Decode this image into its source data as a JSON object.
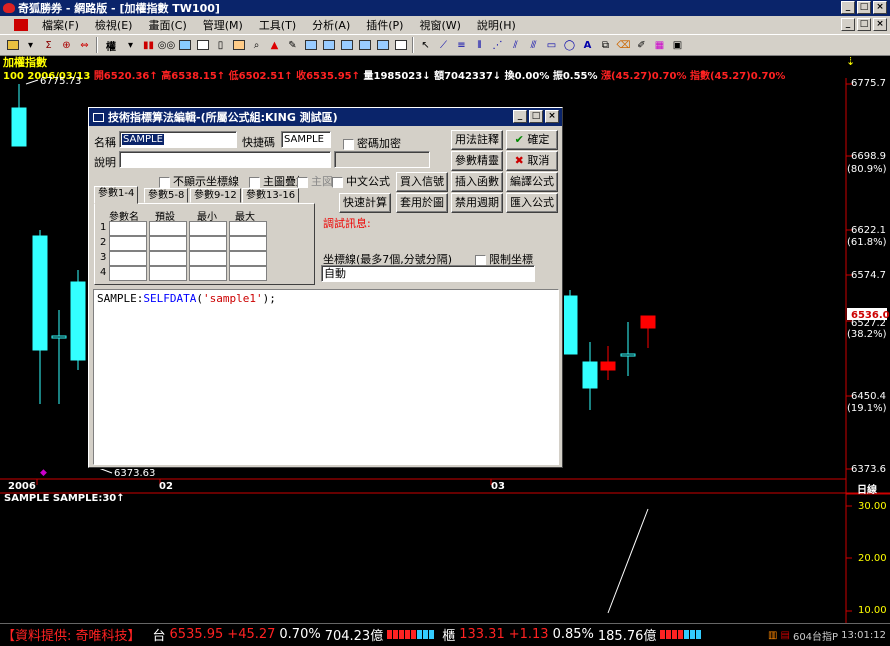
{
  "window": {
    "title": "奇狐勝券 - 網路版 - [加權指數 TW100]"
  },
  "menu": [
    "檔案(F)",
    "檢視(E)",
    "畫面(C)",
    "管理(M)",
    "工具(T)",
    "分析(A)",
    "插件(P)",
    "視窗(W)",
    "說明(H)"
  ],
  "toolbar": {
    "quote_mode": "權"
  },
  "chart": {
    "title": "加權指數",
    "quote": {
      "code": "100",
      "date": "2006/03/13",
      "open": "開6520.36↑",
      "high": "高6538.15↑",
      "low": "低6502.51↑",
      "close": "收6535.95↑",
      "volume": "量1985023↓",
      "amount": "額7042337↓",
      "turnover": "換0.00%",
      "amplitude": "振0.55%",
      "change": "漲(45.27)0.70%",
      "change2": "指數(45.27)0.70%"
    },
    "price_labels": [
      "6775.7",
      "6698.9",
      "6622.1",
      "6574.7",
      "6527.2",
      "6450.4",
      "6373.6"
    ],
    "pct_labels": [
      "(80.9%)",
      "(61.8%)",
      "(38.2%)",
      "(19.1%)"
    ],
    "current_price": "6536.0",
    "high_mark": "6775.73",
    "low_mark": "6373.63",
    "dates": [
      "2006",
      "02",
      "03"
    ],
    "period_label": "日線",
    "indicator": {
      "title": "SAMPLE SAMPLE:30↑",
      "labels": [
        "30.00",
        "20.00",
        "10.00"
      ]
    }
  },
  "statusbar": {
    "provider": "【資料提供: 奇唯科技】",
    "twse_label": "台",
    "twse_price": "6535.95",
    "twse_change": "+45.27",
    "twse_pct": "0.70%",
    "twse_amount": "704.23億",
    "otc_label": "櫃",
    "otc_price": "133.31",
    "otc_change": "+1.13",
    "otc_pct": "0.85%",
    "otc_amount": "185.76億",
    "right_text": "604台指P",
    "time": "13:01:12"
  },
  "dialog": {
    "title": "技術指標算法編輯-(所屬公式組:KING 測試區)",
    "name_label": "名稱",
    "name_value": "SAMPLE",
    "hotkey_label": "快捷碼",
    "hotkey_value": "SAMPLE",
    "password_label": "密碼加密",
    "desc_label": "說明",
    "no_axis_label": "不顯示坐標線",
    "overlay_label": "主圖疊加",
    "main_label": "主図",
    "chinese_label": "中文公式",
    "tabs": [
      "參數1-4",
      "參數5-8",
      "參數9-12",
      "參數13-16"
    ],
    "param_headers": [
      "參數名",
      "預設",
      "最小",
      "最大"
    ],
    "param_rows": [
      "1",
      "2",
      "3",
      "4"
    ],
    "axis_label": "坐標線(最多7個,分號分隔)",
    "limit_label": "限制坐標",
    "axis_value": "自動",
    "debug_label": "調試訊息:",
    "buttons": {
      "usage": "用法註釋",
      "ok": "確定",
      "tune": "參數精靈",
      "cancel": "取消",
      "buy_sell": "買入信號",
      "insert_func": "插入函數",
      "compile": "編譯公式",
      "quick_calc": "快速計算",
      "apply": "套用於圖",
      "disable_period": "禁用週期",
      "import": "匯入公式"
    },
    "code": {
      "name": "SAMPLE",
      "func": "SELFDATA",
      "arg": "'sample1'"
    }
  }
}
